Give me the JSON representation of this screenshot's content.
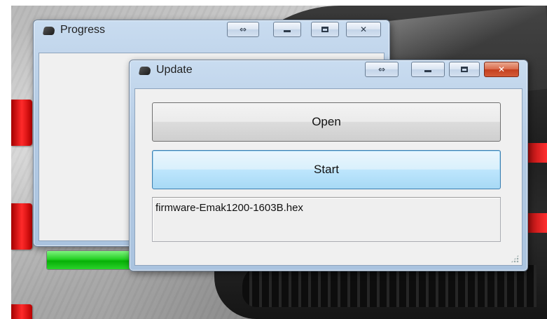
{
  "progress_window": {
    "title": "Progress",
    "progress_fraction": 0.5,
    "buttons": {
      "swap": "⇔",
      "close": "✕"
    }
  },
  "update_window": {
    "title": "Update",
    "open_label": "Open",
    "start_label": "Start",
    "file_text": "firmware-Emak1200-1603B.hex",
    "buttons": {
      "swap": "⇔",
      "close": "✕"
    }
  },
  "colors": {
    "progress_green": "#1dc91d",
    "close_red": "#d35a37",
    "focus_blue": "#3c7fb1"
  }
}
